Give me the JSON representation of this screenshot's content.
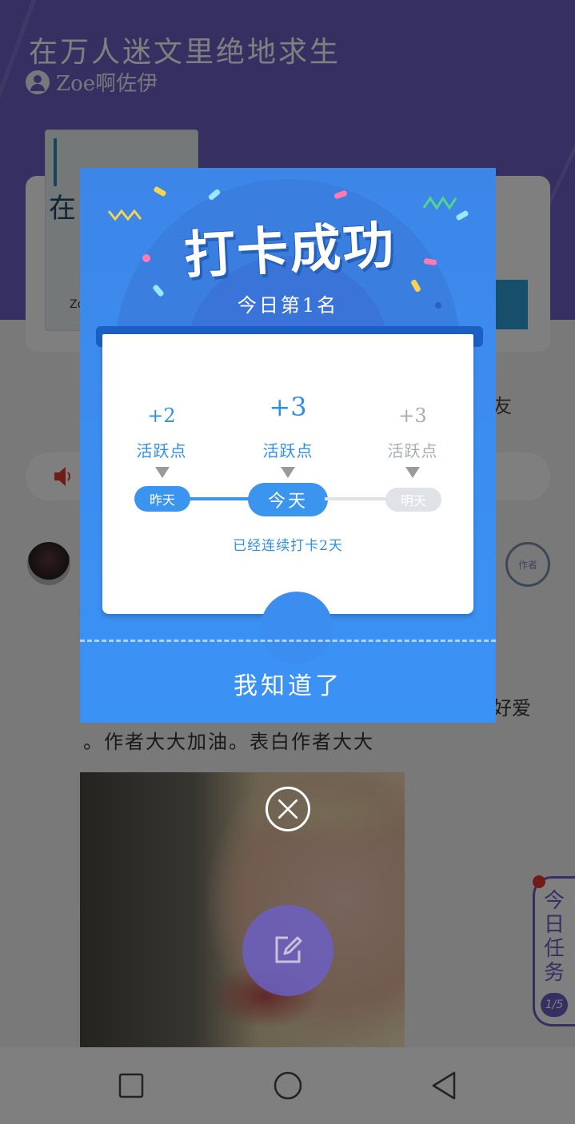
{
  "book": {
    "title": "在万人迷文里绝地求生",
    "author": "Zoe啊佐伊",
    "cover_title": "在",
    "cover_author": "Zoe"
  },
  "background": {
    "friends_text": "友",
    "comment_tail": "好爱",
    "comment_text": "。作者大大加油。表白作者大大",
    "stamp_text": "作者"
  },
  "task_tab": {
    "label": "今日任务",
    "progress": "1/5"
  },
  "dialog": {
    "title": "打卡成功",
    "rank": "今日第1名",
    "days": [
      {
        "points": "+2",
        "unit": "活跃点",
        "label": "昨天",
        "state": "done"
      },
      {
        "points": "+3",
        "unit": "活跃点",
        "label": "今天",
        "state": "current"
      },
      {
        "points": "+3",
        "unit": "活跃点",
        "label": "明天",
        "state": "future"
      }
    ],
    "streak": "已经连续打卡2天",
    "confirm_label": "我知道了"
  },
  "colors": {
    "brand_purple": "#6c5fc2",
    "dialog_blue": "#3b8ef0",
    "accent_blue": "#2f8fe8",
    "future_gray": "#dfe3e8"
  },
  "icons": [
    "user-icon",
    "speaker-icon",
    "stamp-icon",
    "close-icon",
    "edit-icon",
    "square-nav-icon",
    "circle-nav-icon",
    "back-nav-icon"
  ]
}
